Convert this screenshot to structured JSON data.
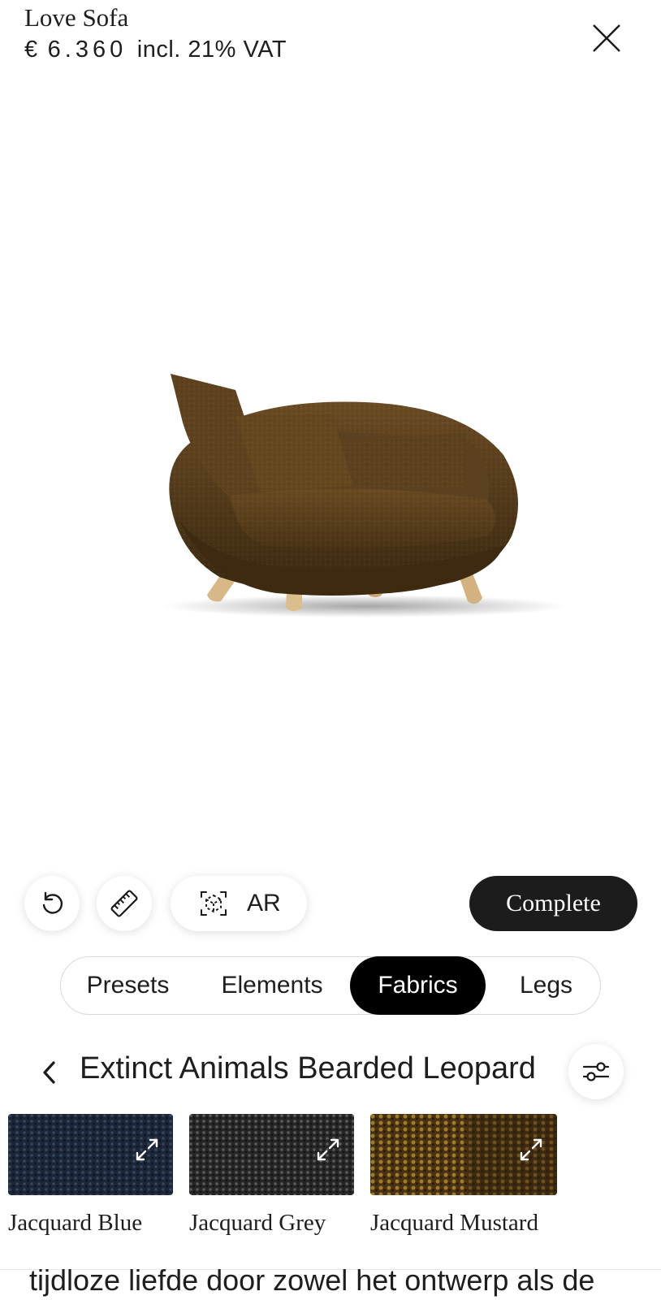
{
  "header": {
    "product_name": "Love Sofa",
    "price": {
      "currency": "€",
      "amount": "6.360",
      "suffix": "incl. 21% VAT"
    },
    "close_icon": "close-icon"
  },
  "viewer": {
    "product_image": "sofa-3d-render",
    "fabric_color": "#5a3f1c",
    "leg_color": "#d8b887"
  },
  "toolbar": {
    "reset_icon": "rotate-ccw-icon",
    "measure_icon": "ruler-icon",
    "ar_icon": "ar-cube-icon",
    "ar_label": "AR",
    "complete_label": "Complete"
  },
  "tabs": [
    {
      "label": "Presets",
      "active": false
    },
    {
      "label": "Elements",
      "active": false
    },
    {
      "label": "Fabrics",
      "active": true
    },
    {
      "label": "Legs",
      "active": false
    }
  ],
  "collection": {
    "back_icon": "chevron-left-icon",
    "title": "Extinct Animals Bearded Leopard",
    "filter_icon": "sliders-icon"
  },
  "swatches": [
    {
      "label": "Jacquard Blue",
      "color": "#1f2a3c"
    },
    {
      "label": "Jacquard Grey",
      "color": "#2e2e2e"
    },
    {
      "label": "Jacquard Mustard",
      "color": "#6b4a1c"
    }
  ],
  "description_text": "tijdloze liefde door zowel het ontwerp als de"
}
